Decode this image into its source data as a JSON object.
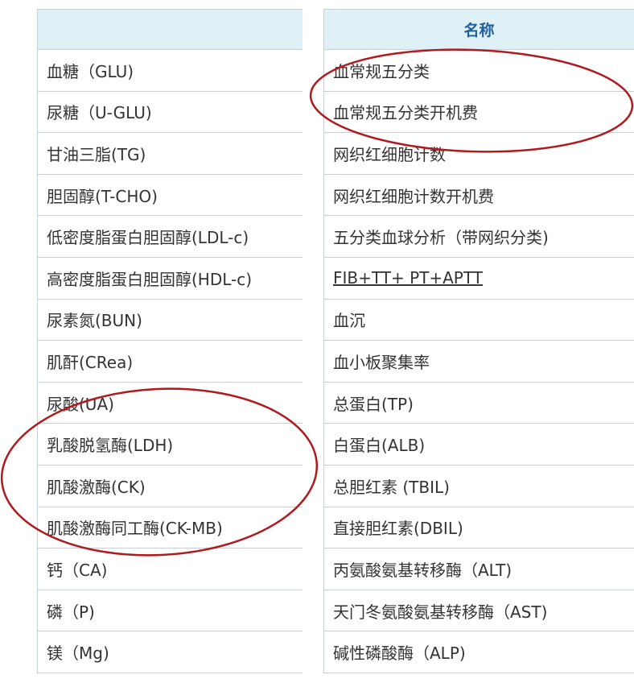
{
  "left_table": {
    "header": "",
    "rows": [
      "血糖（GLU)",
      "尿糖（U-GLU)",
      "甘油三脂(TG)",
      "胆固醇(T-CHO)",
      "低密度脂蛋白胆固醇(LDL-c)",
      "高密度脂蛋白胆固醇(HDL-c)",
      "尿素氮(BUN)",
      "肌酐(CRea)",
      "尿酸(UA)",
      "乳酸脱氢酶(LDH)",
      "肌酸激酶(CK)",
      "肌酸激酶同工酶(CK-MB)",
      "钙（CA)",
      "磷（P)",
      "镁（Mg)"
    ]
  },
  "right_table": {
    "header": "名称",
    "rows": [
      "血常规五分类",
      "血常规五分类开机费",
      "网织红细胞计数",
      "网织红细胞计数开机费",
      "五分类血球分析（带网织分类)",
      "FIB+TT+ PT+APTT",
      "血沉",
      "血小板聚集率",
      "总蛋白(TP)",
      "白蛋白(ALB)",
      "总胆红素 (TBIL)",
      "直接胆红素(DBIL)",
      "丙氨酸氨基转移酶（ALT)",
      "天门冬氨酸氨基转移酶（AST)",
      "碱性磷酸酶（ALP)"
    ]
  },
  "colors": {
    "header_bg": "#dff0f7",
    "header_text": "#1f5f9e",
    "grid_line": "#c9cfd3",
    "body_text": "#333333",
    "annotation_oval": "#b0191e"
  }
}
